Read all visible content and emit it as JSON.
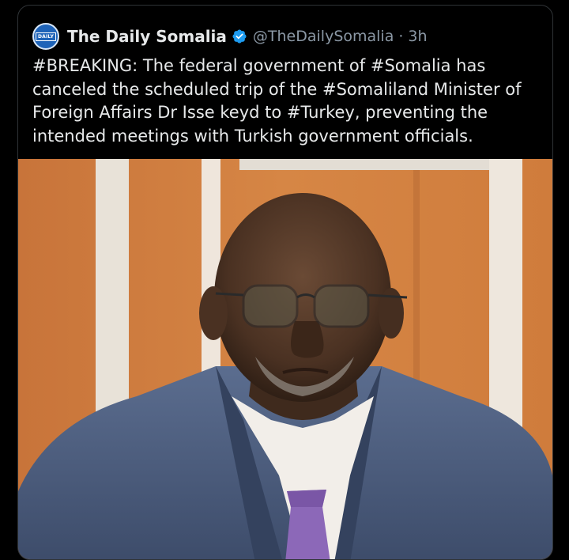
{
  "tweet": {
    "account_name": "The Daily Somalia",
    "handle": "@TheDailySomalia",
    "separator": "·",
    "time": "3h",
    "avatar_text": "DAILY",
    "text": "#BREAKING: The federal government of #Somalia has canceled the scheduled trip of the #Somaliland Minister of Foreign Affairs Dr Isse keyd to #Turkey, preventing the intended meetings with Turkish government officials."
  },
  "icons": {
    "verified": "verified-badge-icon",
    "avatar": "account-avatar"
  },
  "colors": {
    "background": "#000000",
    "text": "#e7e9ea",
    "secondary_text": "#8b98a5",
    "verified_blue": "#1d9bf0",
    "card_border": "#2f3336"
  }
}
